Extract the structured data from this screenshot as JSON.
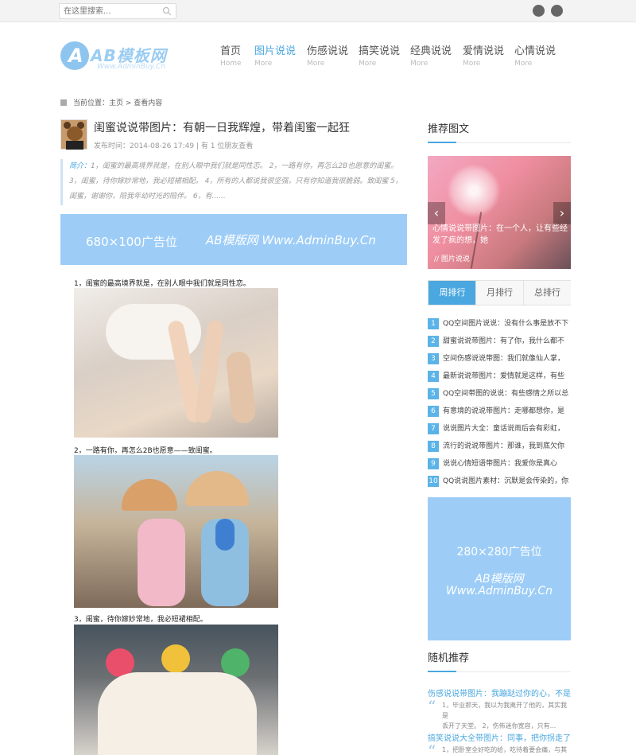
{
  "search": {
    "placeholder": "在这里搜索..."
  },
  "logo": {
    "mark": "A",
    "text": "AB模板网",
    "sub": "Www.AdminBuy.Cn"
  },
  "nav": [
    {
      "label": "首页",
      "sub": "Home"
    },
    {
      "label": "图片说说",
      "sub": "More"
    },
    {
      "label": "伤感说说",
      "sub": "More"
    },
    {
      "label": "搞笑说说",
      "sub": "More"
    },
    {
      "label": "经典说说",
      "sub": "More"
    },
    {
      "label": "爱情说说",
      "sub": "More"
    },
    {
      "label": "心情说说",
      "sub": "More"
    }
  ],
  "breadcrumb": "当前位置：主页 > 查看内容",
  "article": {
    "title": "闺蜜说说带图片：有朝一日我辉煌，带着闺蜜一起狂",
    "meta": "发布时间：2014-08-26 17:49 | 有 1 位朋友查看",
    "summary_label": "简介：",
    "summary_line1": "1，闺蜜的最高境界就是，在别人眼中我们就是同性恋。 2，一路有你，再怎么2B也愿意的闺蜜。",
    "summary_line2": "3，闺蜜，待你嫁妙常地，我必短裙相配。 4，所有的人都说我很坚强，只有你知道我很脆弱。致闺蜜 5，",
    "summary_line3": "闺蜜，谢谢你，陪我年幼时光的陪伴。 6，有......",
    "ad_size": "680×100广告位",
    "ad_text": "AB模版网  Www.AdminBuy.Cn",
    "captions": [
      "1，闺蜜的最高境界就是，在别人眼中我们就是同性恋。",
      "2，一路有你，再怎么2B也愿意——致闺蜜。",
      "3，闺蜜，待你嫁妙常地，我必短裙相配。"
    ]
  },
  "sidebar": {
    "recommend_title": "推荐图文",
    "slider_caption": "心情说说带图片：在一个人，让有些经发了疯的想，她",
    "slider_category": "// 图片说说",
    "tabs": [
      "周排行",
      "月排行",
      "总排行"
    ],
    "rank": [
      {
        "n": "1",
        "text": "QQ空间图片说说：没有什么事是放不下"
      },
      {
        "n": "2",
        "text": "甜蜜说说带图片：有了你，我什么都不"
      },
      {
        "n": "3",
        "text": "空间伤感说说带图：我们就像仙人掌，"
      },
      {
        "n": "4",
        "text": "最新说说带图片：爱情就是这样，有些"
      },
      {
        "n": "5",
        "text": "QQ空间带图的说说：有些感情之所以总"
      },
      {
        "n": "6",
        "text": "有意境的说说带图片：走哪都想你，是"
      },
      {
        "n": "7",
        "text": "说说图片大全：童话说雨后会有彩虹，"
      },
      {
        "n": "8",
        "text": "流行的说说带图片：那谁，我到底欠你"
      },
      {
        "n": "9",
        "text": "说说心情短语带图片：我爱你是真心"
      },
      {
        "n": "10",
        "text": "QQ说说图片素材：沉默是会传染的，你"
      }
    ],
    "ad_size": "280×280广告位",
    "ad_line1": "AB模版网",
    "ad_line2": "Www.AdminBuy.Cn",
    "random_title": "随机推荐",
    "random": [
      {
        "title": "伤感说说带图片：我蹦跶过你的心，不是",
        "desc1": "1，毕业那天，我以为我离开了他的，其实我是",
        "desc2": "丢开了天堂。 2，伤佈迷你宽容，只有..."
      },
      {
        "title": "搞笑说说大全带图片：同事，把你拐走了",
        "desc1": "1，把卧室全好吃的给，吃待着要会痛，与其只",
        "desc2": ""
      }
    ]
  }
}
